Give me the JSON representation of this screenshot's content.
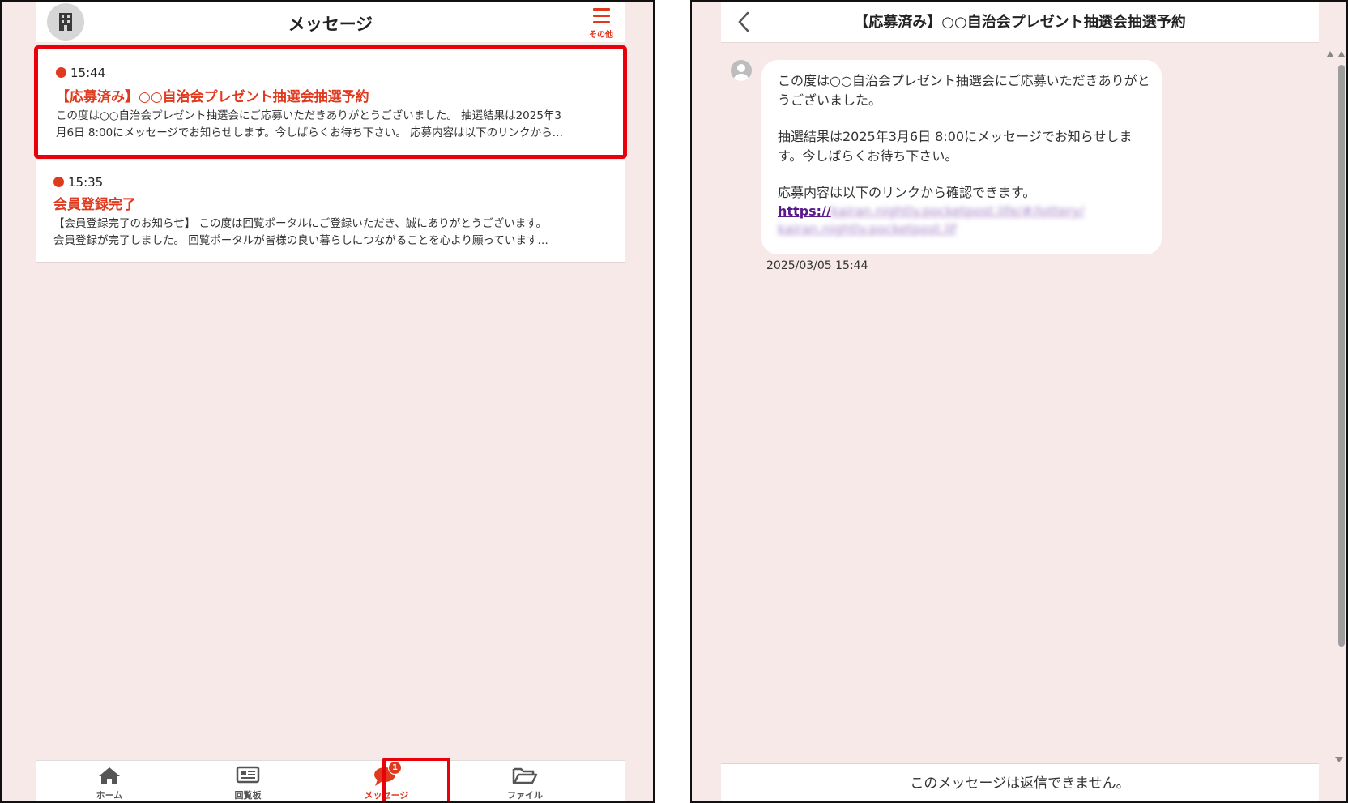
{
  "colors": {
    "accent": "#e03a1e",
    "highlight": "#e8000a",
    "background": "#f7e9e7",
    "link": "#5a1a8c"
  },
  "left": {
    "header": {
      "title": "メッセージ",
      "menu_label": "その他",
      "avatar_icon": "building-icon",
      "menu_icon": "hamburger-icon"
    },
    "messages": [
      {
        "time": "15:44",
        "title": "【応募済み】○○自治会プレゼント抽選会抽選予約",
        "preview_line1": "この度は○○自治会プレゼント抽選会にご応募いただきありがとうございました。 抽選結果は2025年3",
        "preview_line2": "月6日 8:00にメッセージでお知らせします。今しばらくお待ち下さい。 応募内容は以下のリンクから…",
        "unread": true
      },
      {
        "time": "15:35",
        "title": "会員登録完了",
        "preview_line1": "【会員登録完了のお知らせ】 この度は回覧ポータルにご登録いただき、誠にありがとうございます。",
        "preview_line2": "会員登録が完了しました。 回覧ポータルが皆様の良い暮らしにつながることを心より願っています…",
        "unread": true
      }
    ],
    "nav": [
      {
        "label": "ホーム",
        "icon": "home-icon"
      },
      {
        "label": "回覧板",
        "icon": "newspaper-icon"
      },
      {
        "label": "メッセージ",
        "icon": "chat-bubble-icon",
        "badge": "1",
        "active": true
      },
      {
        "label": "ファイル",
        "icon": "folder-open-icon"
      }
    ]
  },
  "right": {
    "header": {
      "title": "【応募済み】○○自治会プレゼント抽選会抽選予約",
      "back_icon": "chevron-left-icon"
    },
    "message": {
      "para1_line1": "この度は○○自治会プレゼント抽選会にご応募いただきありがと",
      "para1_line2": "うございました。",
      "para2_line1": "抽選結果は2025年3月6日 8:00にメッセージでお知らせしま",
      "para2_line2": "す。今しばらくお待ち下さい。",
      "para3_line1": "応募内容は以下のリンクから確認できます。",
      "link_prefix": "https://",
      "link_blurred1": "kairan.nightly.pocketpost.life/#/lottery/",
      "link_blurred2": "kairan.nightly.pocketpost.lif",
      "date": "2025/03/05 15:44"
    },
    "footer": {
      "text": "このメッセージは返信できません。"
    }
  }
}
